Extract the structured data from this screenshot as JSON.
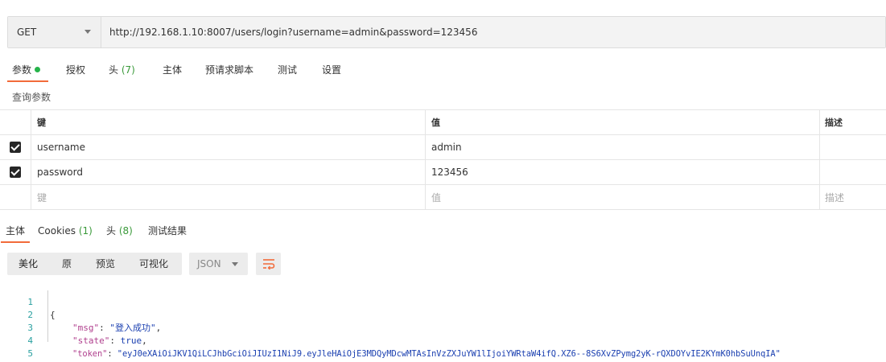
{
  "request": {
    "method": "GET",
    "url": "http://192.168.1.10:8007/users/login?username=admin&password=123456"
  },
  "request_tabs": [
    {
      "label": "参数",
      "active": true,
      "has_dot": true
    },
    {
      "label": "授权"
    },
    {
      "label": "头",
      "count": "(7)"
    },
    {
      "label": "主体"
    },
    {
      "label": "预请求脚本"
    },
    {
      "label": "测试"
    },
    {
      "label": "设置"
    }
  ],
  "query_section_label": "查询参数",
  "params_table": {
    "headers": {
      "key": "键",
      "value": "值",
      "description": "描述"
    },
    "rows": [
      {
        "checked": true,
        "key": "username",
        "value": "admin",
        "description": ""
      },
      {
        "checked": true,
        "key": "password",
        "value": "123456",
        "description": ""
      }
    ],
    "placeholder": {
      "key": "键",
      "value": "值",
      "description": "描述"
    }
  },
  "response_tabs": [
    {
      "label": "主体",
      "active": true
    },
    {
      "label": "Cookies",
      "count": "(1)"
    },
    {
      "label": "头",
      "count": "(8)"
    },
    {
      "label": "测试结果"
    }
  ],
  "view_modes": [
    "美化",
    "原",
    "预览",
    "可视化"
  ],
  "active_view_mode": "美化",
  "format": "JSON",
  "wrap_icon": "wrap-lines-icon",
  "response_body": {
    "line_numbers": [
      "1",
      "2",
      "3",
      "4",
      "5"
    ],
    "open_brace": "{",
    "close_brace": "}",
    "msg_key": "\"msg\"",
    "msg_value": "\"登入成功\"",
    "state_key": "\"state\"",
    "state_value": "true",
    "token_key": "\"token\"",
    "token_value": "\"eyJ0eXAiOiJKV1QiLCJhbGciOiJIUzI1NiJ9.eyJleHAiOjE3MDQyMDcwMTAsInVzZXJuYW1lIjoiYWRtaW4ifQ.XZ6--8S6XvZPymg2yK-rQXDOYvIE2KYmK0hbSuUnqIA\""
  },
  "colors": {
    "accent": "#f26b3a",
    "active_dot": "#26b34a",
    "count": "#3a9a3a",
    "json_key": "#b0408e",
    "json_value": "#1a3fb0"
  }
}
